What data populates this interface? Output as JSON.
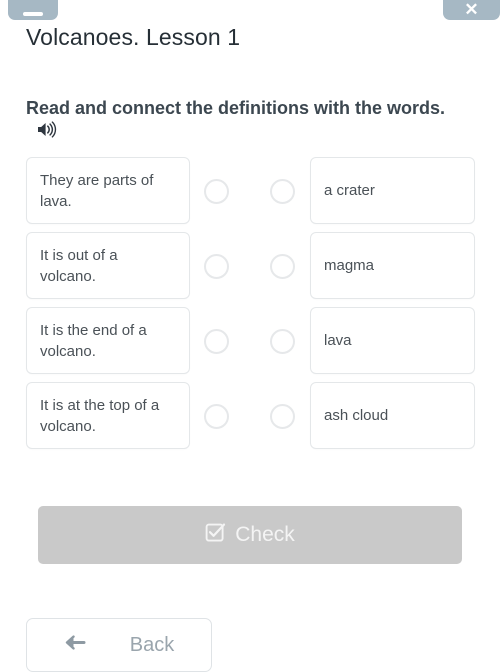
{
  "window": {
    "minimize_glyph": "minimize-bar",
    "close_glyph": "✕"
  },
  "header": {
    "title": "Volcanoes. Lesson 1"
  },
  "task": {
    "instruction": "Read and connect the definitions with the words.",
    "audio_icon": "speaker-icon"
  },
  "match": {
    "rows": [
      {
        "definition": "They are parts of lava.",
        "word": "a crater"
      },
      {
        "definition": "It is out of a volcano.",
        "word": "magma"
      },
      {
        "definition": "It is the end of a volcano.",
        "word": "lava"
      },
      {
        "definition": "It is at the top of a volcano.",
        "word": "ash cloud"
      }
    ]
  },
  "actions": {
    "check_label": "Check",
    "check_icon": "checkbox-checked-icon",
    "check_disabled_color": "#c9c9c9",
    "back_label": "Back",
    "back_icon": "arrow-left-icon"
  },
  "colors": {
    "chrome": "#a6b8c4",
    "title_text": "#262f36",
    "instruction_text": "#3c4750",
    "card_border": "#e4e7e9",
    "card_text": "#4a5157",
    "dot_border": "#e6e8ea",
    "back_text": "#9aa5ad",
    "background": "#ffffff"
  }
}
